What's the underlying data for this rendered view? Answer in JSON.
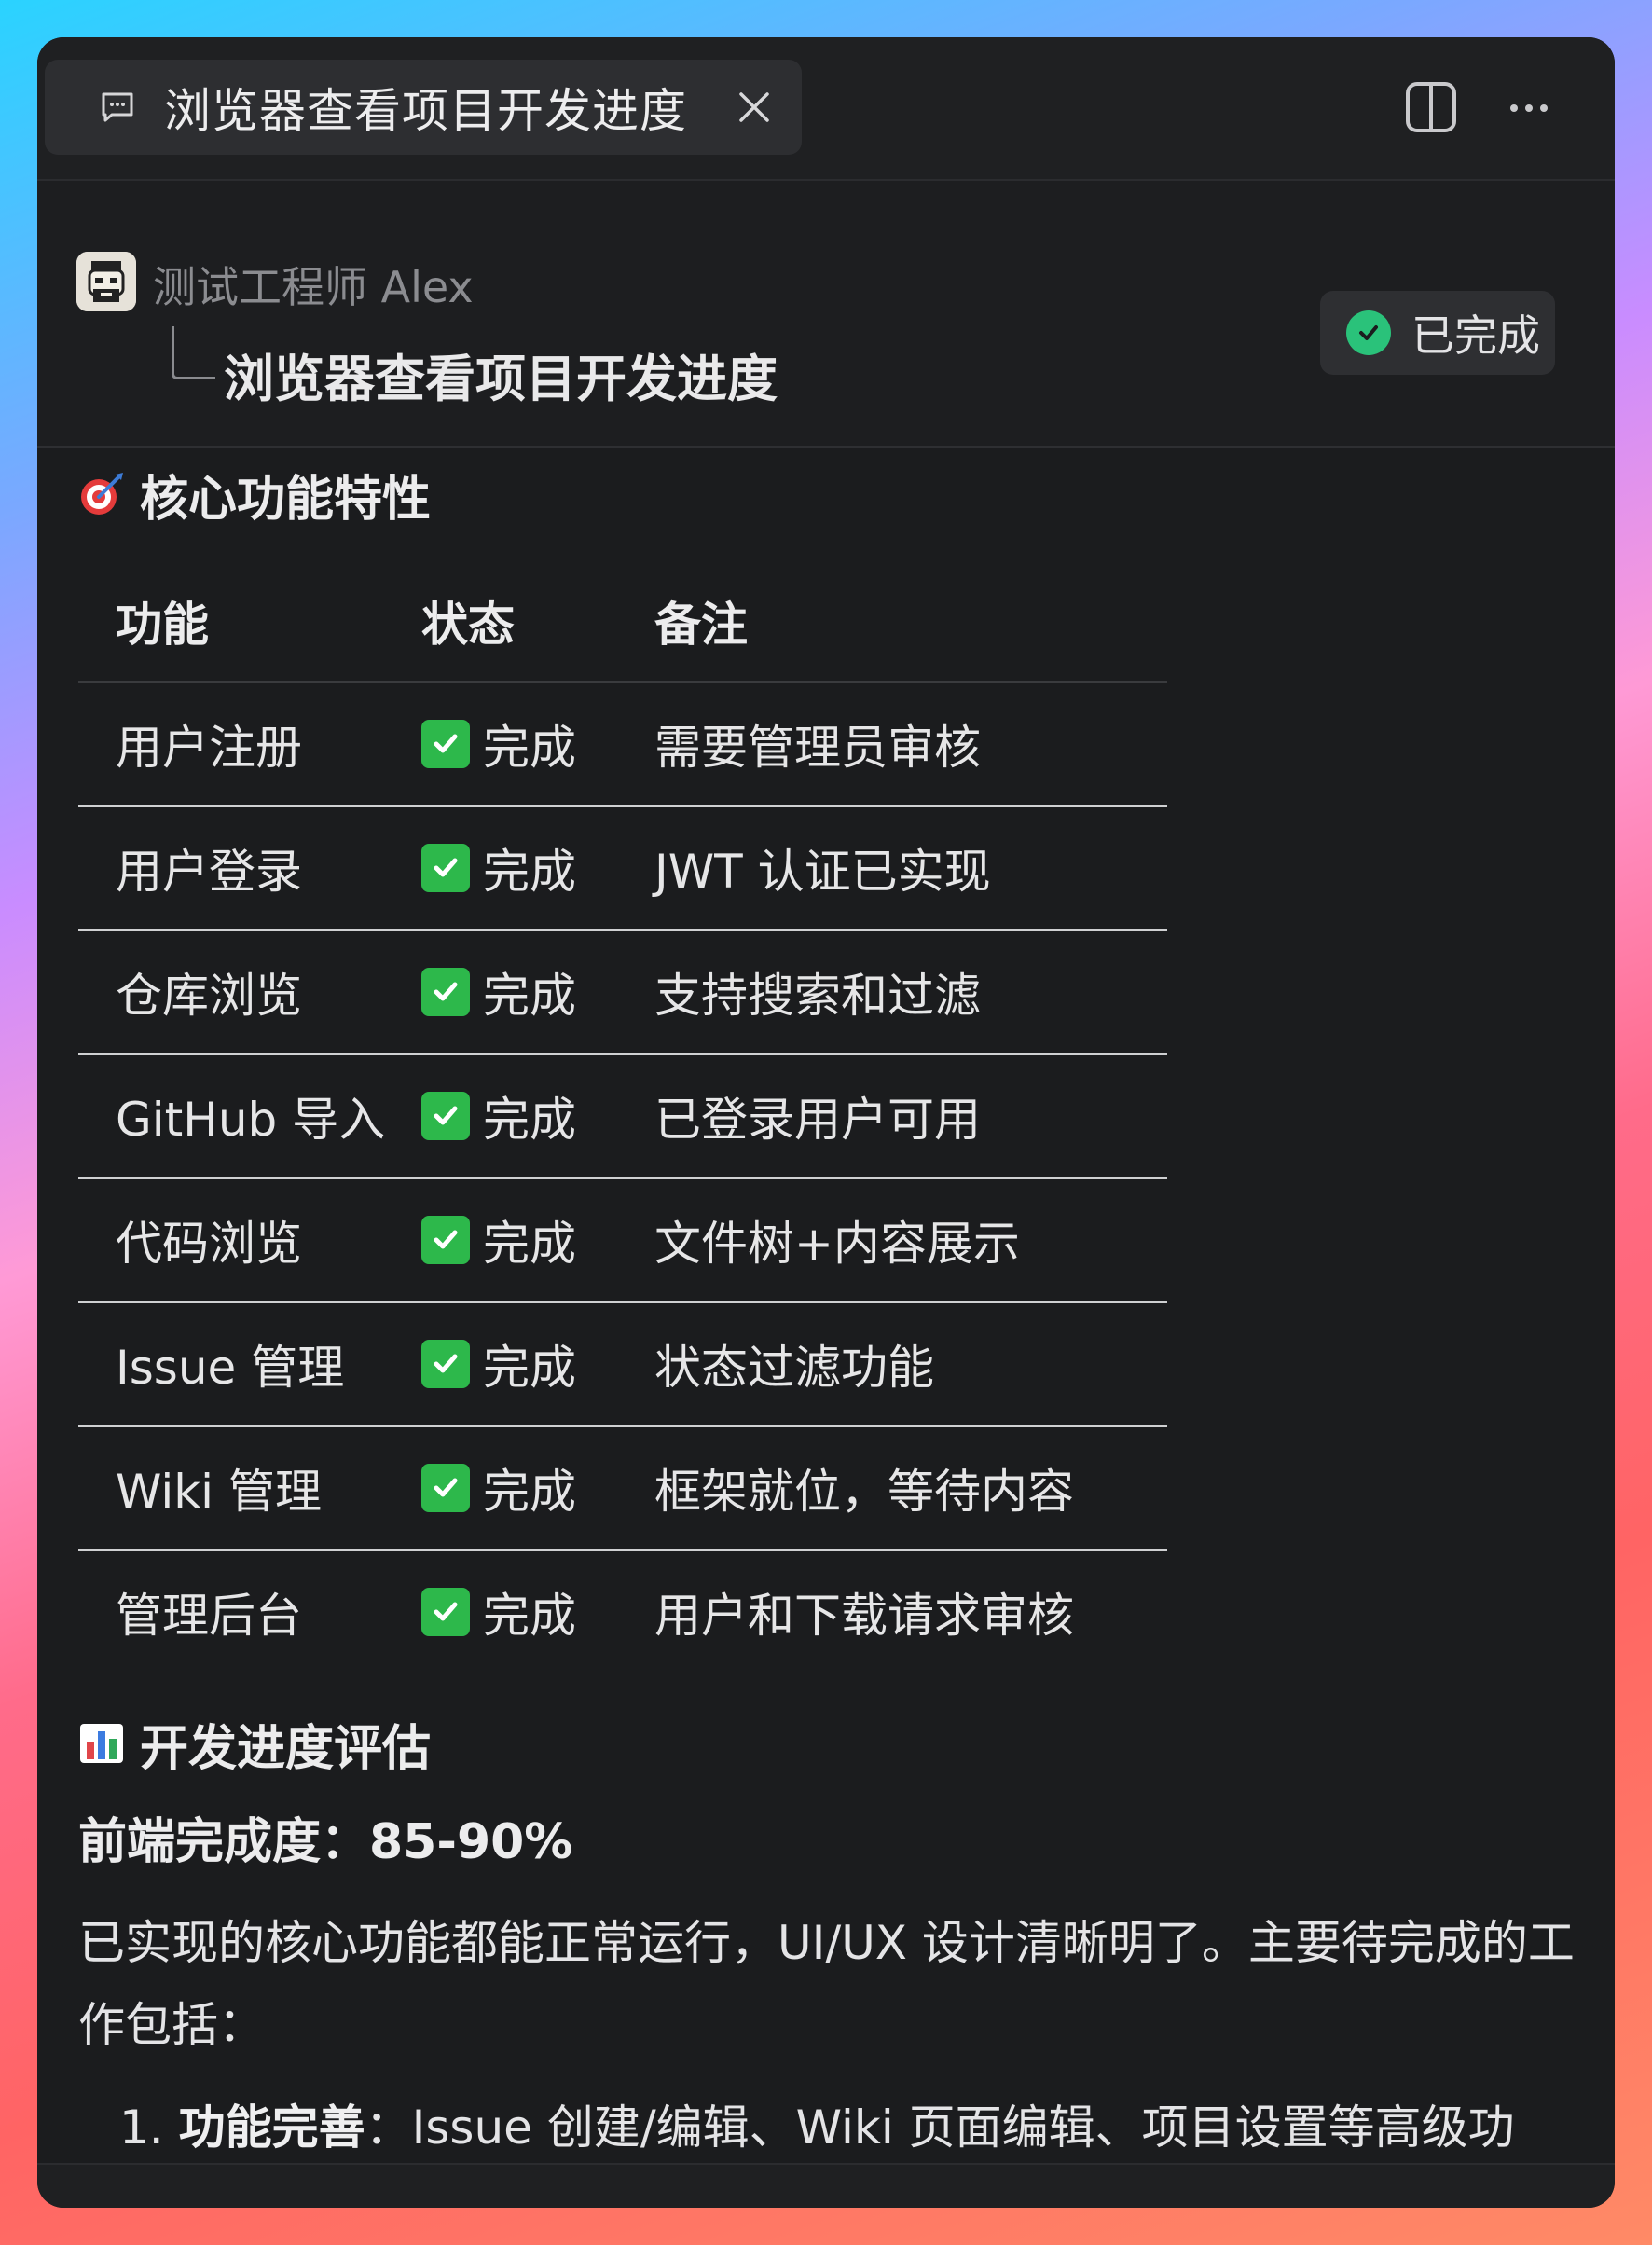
{
  "tab": {
    "title": "浏览器查看项目开发进度",
    "icon": "chat-bubble-icon",
    "close_icon": "close-icon"
  },
  "toolbar": {
    "split_icon": "split-view-icon",
    "more_icon": "more-options-icon"
  },
  "header": {
    "agent_name": "测试工程师 Alex",
    "task_title": "浏览器查看项目开发进度",
    "status_label": "已完成",
    "status_color": "#2ac27a"
  },
  "features_section": {
    "title": "核心功能特性",
    "emoji": "target-dart-icon",
    "columns": [
      "功能",
      "状态",
      "备注"
    ],
    "rows": [
      {
        "feature": "用户注册",
        "status": "完成",
        "note": "需要管理员审核"
      },
      {
        "feature": "用户登录",
        "status": "完成",
        "note": "JWT 认证已实现"
      },
      {
        "feature": "仓库浏览",
        "status": "完成",
        "note": "支持搜索和过滤"
      },
      {
        "feature": "GitHub 导入",
        "status": "完成",
        "note": "已登录用户可用"
      },
      {
        "feature": "代码浏览",
        "status": "完成",
        "note": "文件树+内容展示"
      },
      {
        "feature": "Issue 管理",
        "status": "完成",
        "note": "状态过滤功能"
      },
      {
        "feature": "Wiki 管理",
        "status": "完成",
        "note": "框架就位，等待内容"
      },
      {
        "feature": "管理后台",
        "status": "完成",
        "note": "用户和下载请求审核"
      }
    ]
  },
  "progress_section": {
    "title": "开发进度评估",
    "emoji": "bar-chart-icon",
    "frontend_label": "前端完成度：85-90%",
    "paragraph": "已实现的核心功能都能正常运行，UI/UX 设计清晰明了。主要待完成的工作包括：",
    "list": [
      {
        "number": "1.",
        "bold": "功能完善",
        "text": "：Issue 创建/编辑、Wiki 页面编辑、项目设置等高级功"
      }
    ]
  }
}
